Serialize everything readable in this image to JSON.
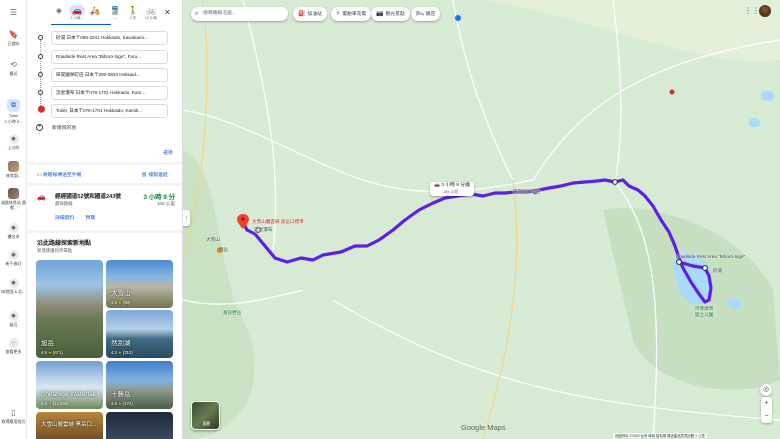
{
  "rail": {
    "menu_icon": "menu-icon",
    "saved_label": "已儲存",
    "recents_label": "最近",
    "toilet_label": "Toilet",
    "toilet_sub": "3 小時 9...",
    "items": [
      {
        "label": "上川町"
      },
      {
        "label": "味覚園..."
      },
      {
        "label": "道路休息站 層雲..."
      },
      {
        "label": "樓名市"
      },
      {
        "label": "新千歲灯"
      },
      {
        "label": "味覚園 & 北..."
      },
      {
        "label": "留辺"
      }
    ],
    "more_label": "查看更多",
    "download_label": "取得應用程式"
  },
  "modes": [
    {
      "name": "best-mode",
      "icon": "◈",
      "time": ""
    },
    {
      "name": "driving-mode",
      "icon": "🚗",
      "time": "3 小時..."
    },
    {
      "name": "motorcycle-mode",
      "icon": "🛵",
      "time": ""
    },
    {
      "name": "transit-mode",
      "icon": "🚆",
      "time": "—"
    },
    {
      "name": "walking-mode",
      "icon": "🚶",
      "time": "3 天"
    },
    {
      "name": "cycling-mode",
      "icon": "🚲",
      "time": "12 小時"
    }
  ],
  "waypoints": [
    "砂湯 日本〒088-3341 Hokkaido, Kawakami...",
    "Roadside Rest Area \"Bihoro-toge\", Furu...",
    "味覚園栄町店 日本〒090-0832 Hokkaid...",
    "流星瀑布 日本〒078-1701 Hokkaido, Kam...",
    "Toilet, 日本〒078-1701 Hokkaido, Kamik..."
  ],
  "add_destination": "新增目的地",
  "options_label": "選項",
  "send_to_phone": "將路線傳送至手機",
  "copy_link": "複製連結",
  "route": {
    "via": "經經國道52號和國道243號",
    "subtitle": "最快路線",
    "time": "3 小時 9 分",
    "distance": "168 公里",
    "details": "詳細資料",
    "preview": "預覽"
  },
  "explore": {
    "title": "沿此路線探索新地點",
    "subtitle": "新增建議的停靠點",
    "cards": [
      {
        "name": "旭岳",
        "rating": "4.8",
        "count": "(671)"
      },
      {
        "name": "大雪山",
        "rating": "4.5",
        "count": "(90)"
      },
      {
        "name": "然別湖",
        "rating": "4.3",
        "count": "(312)"
      },
      {
        "name": "Shirahige Waterfall",
        "rating": "4.4",
        "count": "(12,482)"
      },
      {
        "name": "十勝岳",
        "rating": "4.6",
        "count": "(174)"
      },
      {
        "name": "大雪山層雲峽 黑岳口...",
        "rating": "",
        "count": ""
      },
      {
        "name": "",
        "rating": "",
        "count": ""
      }
    ]
  },
  "map": {
    "search_placeholder": "搜尋路線沿途...",
    "chips": [
      {
        "icon": "⛽",
        "label": "加油站"
      },
      {
        "icon": "⚡",
        "label": "電動車充電"
      },
      {
        "icon": "📷",
        "label": "觀光景點"
      },
      {
        "icon": "🛏",
        "label": "飯店"
      }
    ],
    "time_bubble": "3 小時 9 分鐘",
    "time_bubble_distance": "168 公里",
    "labels": {
      "bihoro": "Roadside Rest Area \"Bihoro-toge\"",
      "sunayu": "砂湯",
      "mikakuen": "味覚園栄町店",
      "sounkyo": "大雪山層雲峽 黑岳口標準",
      "waterfall": "流星瀑布",
      "daisetsu": "大雪山",
      "asahi": "旭岳",
      "tokachi": "富良野岳",
      "akan": "阿寒摩周",
      "national_park": "國立公園"
    },
    "layers_label": "圖層",
    "google_logo": "Google Maps",
    "footer": "地圖資料 ©2025  台灣  條款  隱私權  傳送產品意見回饋  1 公里"
  },
  "colors": {
    "route": "#4b3fe0",
    "accent": "#0b57d0",
    "map_bg": "#d7ead3"
  }
}
